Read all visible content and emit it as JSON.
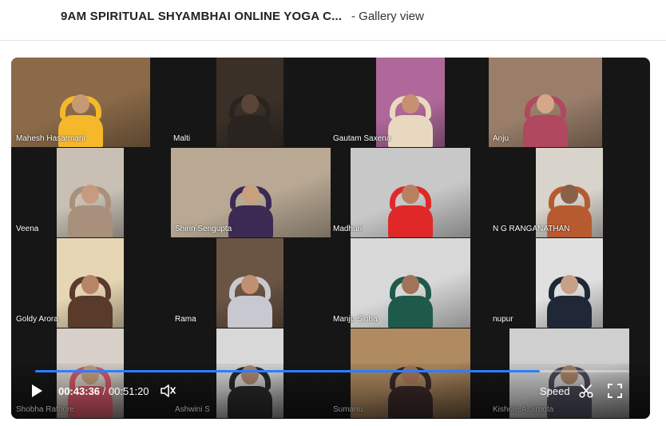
{
  "header": {
    "title": "9AM SPIRITUAL SHYAMBHAI ONLINE YOGA C...",
    "view_label": "- Gallery view"
  },
  "participants": [
    {
      "name": "Mahesh Hasarmani",
      "bg": "#8a6a48",
      "shirt": "#f5b82a",
      "skin": "#c79a74"
    },
    {
      "name": "Malti",
      "bg": "#3a3028",
      "shirt": "#2a2420",
      "skin": "#5a4638"
    },
    {
      "name": "Gautam Saxena",
      "bg": "#b0689a",
      "shirt": "#e8d8c0",
      "skin": "#c89070"
    },
    {
      "name": "Anju",
      "bg": "#9a7e6a",
      "shirt": "#b04860",
      "skin": "#d4a888"
    },
    {
      "name": "Veena",
      "bg": "#c8c0b4",
      "shirt": "#a8907c",
      "skin": "#c89a80"
    },
    {
      "name": "Shirin Sengupta",
      "bg": "#b8a894",
      "shirt": "#3c2a54",
      "skin": "#c8a080"
    },
    {
      "name": "Madhuri",
      "bg": "#c8c8c8",
      "shirt": "#e02828",
      "skin": "#b88060"
    },
    {
      "name": "N G RANGANATHAN",
      "bg": "#d8d4cc",
      "shirt": "#b85a30",
      "skin": "#8a6048"
    },
    {
      "name": "Goldy Arora",
      "bg": "#e6d6b4",
      "shirt": "#5a3a2a",
      "skin": "#b88468"
    },
    {
      "name": "Rama",
      "bg": "#6a5444",
      "shirt": "#c8c8d0",
      "skin": "#c09070"
    },
    {
      "name": "Manju Sinha",
      "bg": "#d8d8d8",
      "shirt": "#1e5a4a",
      "skin": "#a07458"
    },
    {
      "name": "nupur",
      "bg": "#e0e0e0",
      "shirt": "#202838",
      "skin": "#c8a088"
    },
    {
      "name": "Shobha Rathore",
      "bg": "#d8d0c8",
      "shirt": "#d85a6a",
      "skin": "#c8a080"
    },
    {
      "name": "Ashwini S",
      "bg": "#d8d8d8",
      "shirt": "#2a2a2a",
      "skin": "#b08870"
    },
    {
      "name": "Sumanu",
      "bg": "#b08a60",
      "shirt": "#3a2a2a",
      "skin": "#a87858"
    },
    {
      "name": "Kishore Asarpota",
      "bg": "#cfcfcf",
      "shirt": "#4a4a5a",
      "skin": "#a88468"
    }
  ],
  "player": {
    "current_time": "00:43:36",
    "separator": "/",
    "duration": "00:51:20",
    "progress": 0.849,
    "speed_label": "Speed",
    "accent_color": "#2a7fff"
  }
}
